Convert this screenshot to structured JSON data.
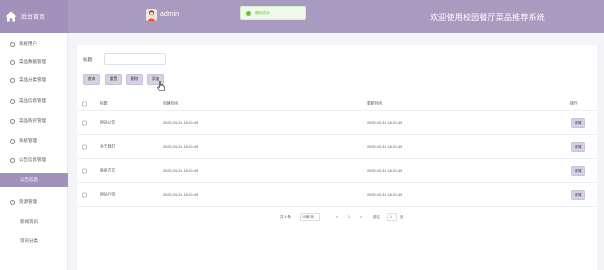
{
  "header": {
    "logo_label": "后台首页",
    "admin_name": "admin",
    "site_title": "欢迎使用校园餐厅菜品推荐系统",
    "toast_text": "删除成功!"
  },
  "sidebar": {
    "items": [
      {
        "label": "系统用户"
      },
      {
        "label": "菜品数据管理"
      },
      {
        "label": "菜品分类管理"
      },
      {
        "label": "菜品信息管理"
      },
      {
        "label": "菜品购买管理"
      },
      {
        "label": "系统管理"
      },
      {
        "label": "公告信息管理"
      },
      {
        "label": "公告信息"
      },
      {
        "label": "资源管理"
      },
      {
        "label": "新闻资讯"
      },
      {
        "label": "资讯分类"
      }
    ]
  },
  "toolbar": {
    "title_label": "标题:",
    "title_value": "",
    "search_label": "查询",
    "reset_label": "重置",
    "delete_label": "删除",
    "add_label": "添加"
  },
  "table": {
    "columns": [
      "标题",
      "创建时间",
      "更新时间",
      "操作"
    ],
    "rows": [
      {
        "title": "网站公告",
        "created": "2025-03-31 18:21:49",
        "updated": "2025-03-31 18:21:49",
        "action": "详情"
      },
      {
        "title": "关于我们",
        "created": "2025-03-31 18:21:49",
        "updated": "2025-03-31 18:21:49",
        "action": "详情"
      },
      {
        "title": "联系方式",
        "created": "2025-03-31 18:21:49",
        "updated": "2025-03-31 18:21:49",
        "action": "详情"
      },
      {
        "title": "网站介绍",
        "created": "2025-03-31 18:21:49",
        "updated": "2025-03-31 18:21:49",
        "action": "详情"
      }
    ]
  },
  "pagination": {
    "total": "共 4 条",
    "page_size": "10条/页",
    "prev": "<",
    "current_page": "1",
    "next": ">",
    "goto_label": "前往",
    "goto_value": "1",
    "page_suffix": "页"
  },
  "colors": {
    "header_bg": "#a99bc0",
    "accent": "#a291bb",
    "button_bg": "#d8d0e4",
    "toast_green": "#67c23a"
  }
}
